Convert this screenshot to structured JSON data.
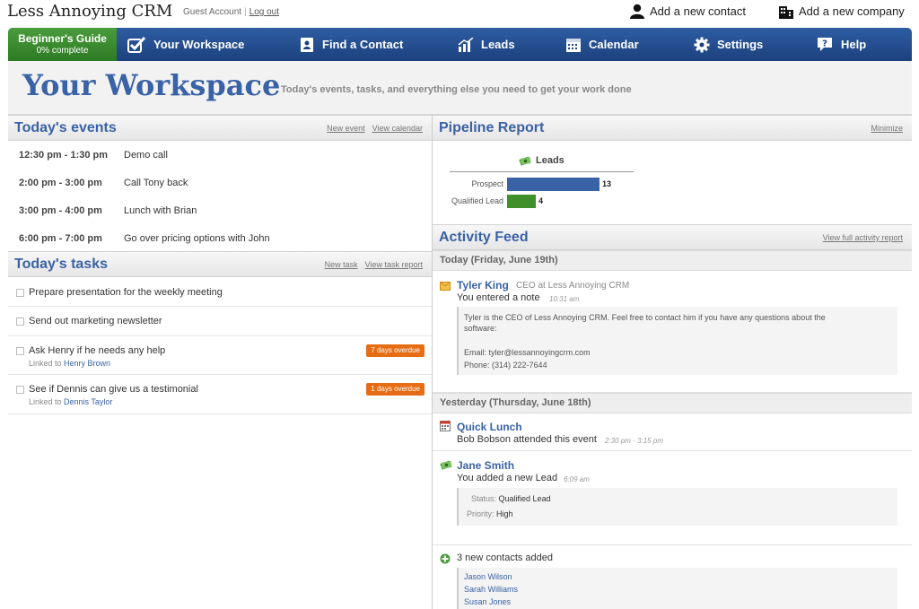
{
  "brand": "Less Annoying CRM",
  "guest": {
    "label": "Guest Account",
    "separator": "|",
    "logout": "Log out"
  },
  "top_actions": {
    "add_contact": "Add a new contact",
    "add_company": "Add a new company"
  },
  "guide": {
    "title": "Beginner's Guide",
    "progress": "0% complete"
  },
  "nav": {
    "workspace": "Your Workspace",
    "find": "Find a Contact",
    "leads": "Leads",
    "calendar": "Calendar",
    "settings": "Settings",
    "help": "Help"
  },
  "header": {
    "title": "Your Workspace",
    "subtitle": "Today's events, tasks, and everything else you need to get your work done"
  },
  "events": {
    "title": "Today's events",
    "new_link": "New event",
    "view_link": "View calendar",
    "items": [
      {
        "time": "12:30 pm - 1:30 pm",
        "desc": "Demo call"
      },
      {
        "time": "2:00 pm - 3:00 pm",
        "desc": "Call Tony back"
      },
      {
        "time": "3:00 pm - 4:00 pm",
        "desc": "Lunch with Brian"
      },
      {
        "time": "6:00 pm - 7:00 pm",
        "desc": "Go over pricing options with John"
      }
    ]
  },
  "tasks": {
    "title": "Today's tasks",
    "new_link": "New task",
    "view_link": "View task report",
    "items": [
      {
        "text": "Prepare presentation for the weekly meeting"
      },
      {
        "text": "Send out marketing newsletter"
      },
      {
        "text": "Ask Henry if he needs any help",
        "linked_label": "Linked to",
        "linked": "Henry Brown",
        "badge": "7 days overdue"
      },
      {
        "text": "See if Dennis can give us a testimonial",
        "linked_label": "Linked to",
        "linked": "Dennis Taylor",
        "badge": "1 days overdue"
      }
    ]
  },
  "pipeline": {
    "title": "Pipeline Report",
    "minimize": "Minimize",
    "chart_data": {
      "type": "bar",
      "title": "Leads",
      "categories": [
        "Prospect",
        "Qualified Lead"
      ],
      "values": [
        13,
        4
      ],
      "colors": [
        "#3a62a6",
        "#3f8f2a"
      ]
    }
  },
  "feed": {
    "title": "Activity Feed",
    "view_link": "View full activity report",
    "today_label": "Today (Friday, June 19th)",
    "yesterday_label": "Yesterday (Thursday, June 18th)",
    "note": {
      "name": "Tyler King",
      "role": "CEO at Less Annoying CRM",
      "action": "You entered a note",
      "time": "10:31 am",
      "body1": "Tyler is the CEO of Less Annoying CRM. Feel free to contact him if you have any questions about the",
      "body2": "software:",
      "email": "Email: tyler@lessannoyingcrm.com",
      "phone": "Phone: (314) 222-7644"
    },
    "event": {
      "name": "Quick Lunch",
      "action": "Bob Bobson attended this event",
      "time": "2:30 pm - 3:15 pm"
    },
    "lead": {
      "name": "Jane Smith",
      "action": "You added a new Lead",
      "time": "6:09 am",
      "status_label": "Status:",
      "status": "Qualified Lead",
      "priority_label": "Priority:",
      "priority": "High"
    },
    "contacts": {
      "text": "3 new contacts added",
      "names": [
        "Jason Wilson",
        "Sarah Williams",
        "Susan Jones"
      ]
    }
  }
}
